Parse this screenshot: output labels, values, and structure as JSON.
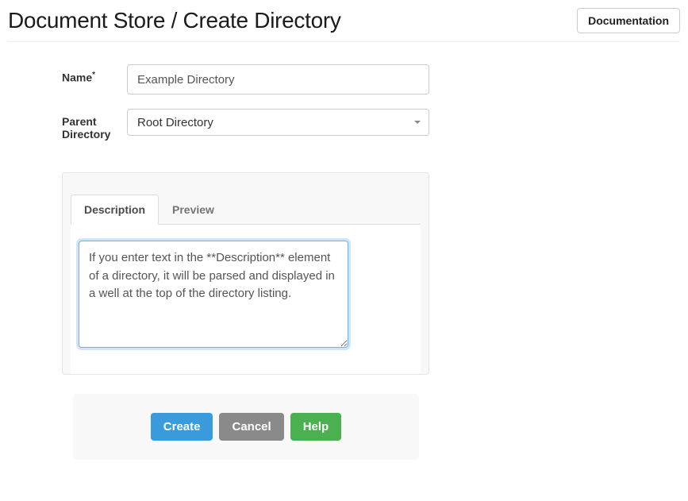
{
  "header": {
    "title": "Document Store / Create Directory",
    "documentation_label": "Documentation"
  },
  "form": {
    "name_label": "Name",
    "name_required_marker": "*",
    "name_value": "Example Directory",
    "parent_label": "Parent Directory",
    "parent_value": "Root Directory"
  },
  "tabs": {
    "description_label": "Description",
    "preview_label": "Preview"
  },
  "description_value": "If you enter text in the **Description** element of a directory, it will be parsed and displayed in a well at the top of the directory listing.",
  "actions": {
    "create": "Create",
    "cancel": "Cancel",
    "help": "Help"
  }
}
